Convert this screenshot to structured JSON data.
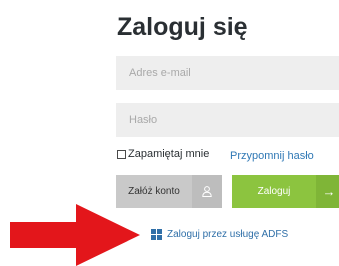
{
  "login": {
    "title": "Zaloguj się",
    "email_placeholder": "Adres e-mail",
    "password_placeholder": "Hasło",
    "remember_label": "Zapamiętaj mnie",
    "forgot_label": "Przypomnij hasło",
    "register_label": "Załóż konto",
    "register_icon": "user-icon",
    "login_label": "Zaloguj",
    "login_icon": "arrow-right-icon",
    "adfs_label": "Zaloguj przez usługę ADFS",
    "adfs_icon": "windows-icon"
  },
  "colors": {
    "login_button": "#8cc43f",
    "register_button": "#c9c9c9",
    "link": "#2f78b5",
    "annotation_arrow": "#e3161b"
  }
}
